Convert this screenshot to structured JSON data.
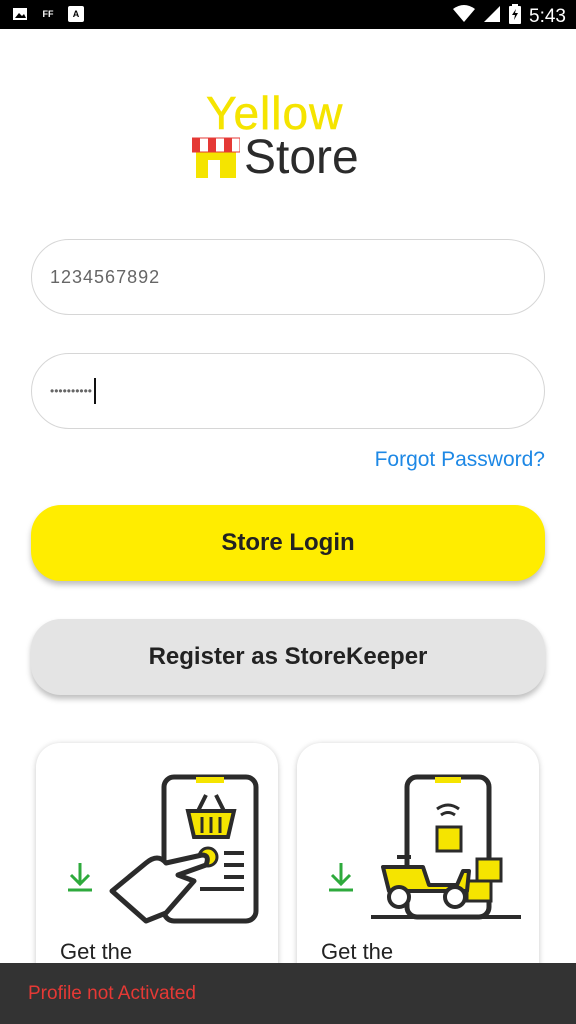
{
  "status_bar": {
    "left_icons": [
      "image-icon",
      "ff-icon",
      "a-icon"
    ],
    "left_labels": [
      "",
      "FF",
      "A"
    ],
    "time": "5:43"
  },
  "logo": {
    "line1": "Yellow",
    "line2": "Store",
    "colors": {
      "yellow": "#f5e400",
      "dark": "#2b2b2b",
      "awning_red": "#e53935"
    }
  },
  "form": {
    "phone_value": "1234567892",
    "password_masked": "••••••••••",
    "forgot_label": "Forgot Password?"
  },
  "buttons": {
    "login_label": "Store Login",
    "register_label": "Register as StoreKeeper"
  },
  "cards": [
    {
      "text": "Get the",
      "icon": "download-icon",
      "illustration": "shopping-app-icon"
    },
    {
      "text": "Get the",
      "icon": "download-icon",
      "illustration": "delivery-app-icon"
    }
  ],
  "snackbar": {
    "message": "Profile not Activated"
  },
  "colors": {
    "accent_yellow": "#ffed00",
    "link_blue": "#1e88e5",
    "error_red": "#e53935",
    "download_green": "#2eaa3c"
  }
}
